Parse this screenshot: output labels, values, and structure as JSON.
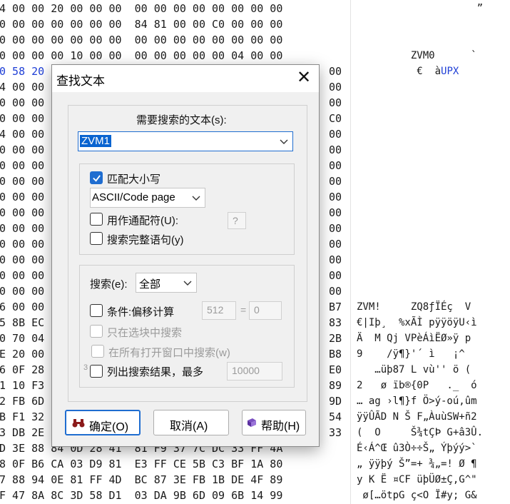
{
  "hex_rows": [
    "4 00 00 20 00 00 00  00 00 00 00 00 00 00 00",
    "0 00 00 00 00 00 00  84 81 00 00 C0 00 00 00",
    "0 00 00 00 00 00 00  00 00 00 00 00 00 00 00",
    "0 00 00 00 10 00 00  00 00 00 00 00 04 00 00",
    "0 58 20",
    "4 00 00",
    "0 00 00",
    "0 00 00",
    "4 00 00",
    "0 00 00",
    "0 00 00",
    "0 00 00",
    "0 00 00",
    "0 00 00",
    "0 00 00",
    "0 00 00",
    "0 00 00",
    "0 00 00",
    "0 00 00",
    "6 00 00",
    "5 8B EC",
    "0 70 04",
    "E 20 00",
    "6 0F 28",
    "1 10 F3",
    "2 FB 6D",
    "B F1 32",
    "3 DB 2E",
    "D 3E 88 84 0D 28 41  81 F9 37 7C DC 33 FF 4A",
    "8 0F B6 CA 03 D9 81  E3 FF CE 5B C3 BF 1A 80",
    "7 88 94 0E 81 FF 4D  BC 87 3E FB 1B DE 4F 89",
    "F 47 8A 8C 3D 58 D1  03 DA 9B 6D 09 6B 14 99"
  ],
  "hex_right_col": [
    "",
    "",
    "",
    "",
    "00",
    "00",
    "00",
    "C0",
    "00",
    "00",
    "00",
    "00",
    "00",
    "00",
    "00",
    "00",
    "00",
    "00",
    "00",
    "B7",
    "83",
    "2B",
    "B8",
    "E0",
    "89",
    "9D",
    "54",
    "33"
  ],
  "ascii_rows": [
    "                    ”",
    "",
    "",
    "         ZVM0      `",
    "          €  àUPX",
    "",
    "",
    "",
    "",
    "",
    "",
    "",
    "",
    "",
    "",
    "",
    "",
    "",
    "",
    "ZVM!     ZQ8ƒÏÉç  V",
    "€|Iþ¸  %xÃÌ pÿÿöÿU‹ì",
    "Ä  M Qj VPèÁìËØ»ÿ p",
    "9    /ÿ¶}'´ ì   ¡^",
    "   …üþ87 L vù'' ö (",
    "2   ø ïb®{0P   ._  ó",
    "… ag ›l¶}f Ö>ý-oú,ûm",
    "ÿÿÛÃD N Š F„ÀuùSW+ñ2",
    "(  O     Š¾tÇÞ G+â3Û.",
    "É‹Á^Œ û3Ò÷÷Š„ Ýþýý>`",
    "„ ÿÿþý Š”=+ ¾„=! Ø ¶",
    "y K Ë ¤CF üþÜØ±Ç,G^\"",
    " ø[…ötpG ç<O Ï#y; G&"
  ],
  "dialog": {
    "title": "查找文本",
    "search_text_label": "需要搜索的文本(s):",
    "search_text_value": "ZVM1",
    "match_case_label": "匹配大小写",
    "encoding_value": "ASCII/Code page",
    "wildcard_label": "用作通配符(U):",
    "wildcard_value": "?",
    "whole_word_label": "搜索完整语句(y)",
    "search_scope_label": "搜索(e):",
    "search_scope_value": "全部",
    "cond_offset_label": "条件:偏移计算",
    "cond_offset_a": "512",
    "cond_offset_eq": "=",
    "cond_offset_b": "0",
    "in_block_label": "只在选块中搜索",
    "all_windows_label": "在所有打开窗口中搜索(w)",
    "list_results_prefix": "3",
    "list_results_label": "列出搜索结果，最多",
    "list_results_value": "10000",
    "ok_label": "确定(O)",
    "cancel_label": "取消(A)",
    "help_label": "帮助(H)"
  },
  "colors": {
    "accent": "#1f6dd0",
    "hex_highlight": "#1f3fd6",
    "selection": "#0a64d0"
  }
}
